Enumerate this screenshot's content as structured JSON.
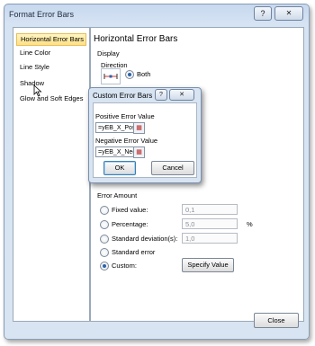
{
  "window": {
    "title": "Format Error Bars",
    "help_label": "?",
    "close_label": "✕"
  },
  "nav": {
    "items": [
      {
        "label": "Horizontal Error Bars"
      },
      {
        "label": "Line Color"
      },
      {
        "label": "Line Style"
      },
      {
        "label": "Shadow"
      },
      {
        "label": "Glow and Soft Edges"
      }
    ]
  },
  "pane": {
    "title": "Horizontal Error Bars",
    "display_label": "Display",
    "direction_label": "Direction",
    "both_label": "Both",
    "error_amount_label": "Error Amount",
    "fixed_label": "Fixed value:",
    "fixed_value": "0,1",
    "percentage_label": "Percentage:",
    "percentage_value": "5,0",
    "percent_sign": "%",
    "stddev_label": "Standard deviation(s):",
    "stddev_value": "1,0",
    "stderr_label": "Standard error",
    "custom_label": "Custom:",
    "specify_label": "Specify Value"
  },
  "custom_dialog": {
    "title": "Custom Error Bars",
    "help_label": "?",
    "close_label": "✕",
    "positive_label": "Positive Error Value",
    "positive_value": "=yEB_X_Pos",
    "negative_label": "Negative Error Value",
    "negative_value": "=yEB_X_Neg",
    "ok_label": "OK",
    "cancel_label": "Cancel"
  },
  "footer": {
    "close_label": "Close"
  },
  "colors": {
    "selection": "#ffe086",
    "frame": "#c7d8ee",
    "radio_dot": "#2c62a7"
  }
}
